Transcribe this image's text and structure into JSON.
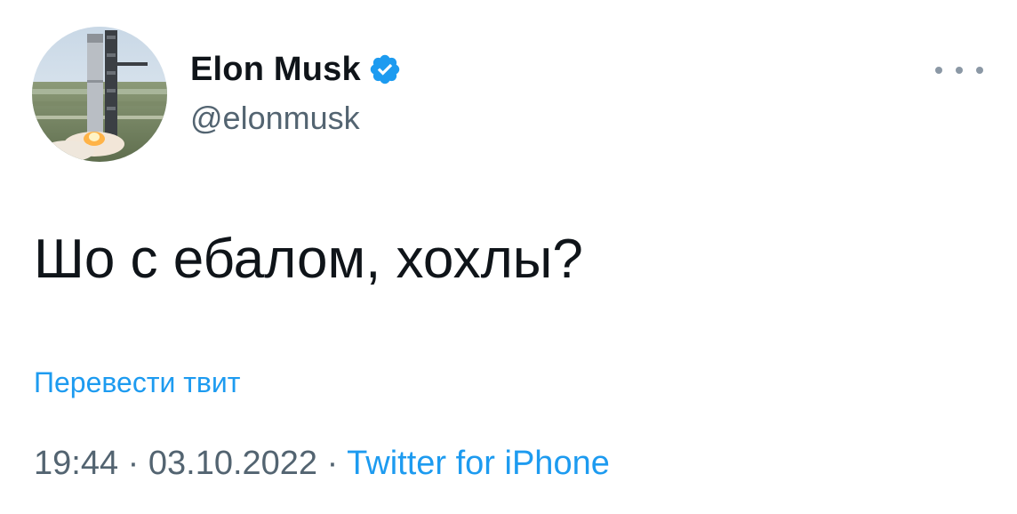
{
  "author": {
    "display_name": "Elon Musk",
    "handle": "@elonmusk",
    "verified_icon": "verified-badge-icon"
  },
  "menu": {
    "icon": "more-options-icon"
  },
  "tweet": {
    "text": "Шо с ебалом, хохлы?",
    "translate_label": "Перевести твит",
    "time": "19:44",
    "separator": "·",
    "date": "03.10.2022",
    "source": "Twitter for iPhone"
  },
  "colors": {
    "accent": "#1d9bf0",
    "text": "#0f1419",
    "secondary_text": "#536471"
  }
}
